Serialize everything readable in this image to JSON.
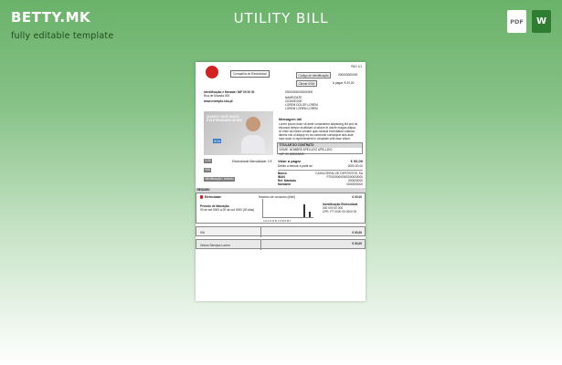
{
  "brand": {
    "name": "BETTY.MK",
    "tagline": "fully editable template"
  },
  "page_title": "UTILITY BILL",
  "formats": [
    {
      "label": "PDF",
      "icon": "pdf-file-icon"
    },
    {
      "label": "W",
      "icon": "word-file-icon"
    }
  ],
  "colors": {
    "background_top": "#6ab26a",
    "background_bottom": "#ffffff",
    "logo_red": "#d32020"
  },
  "document": {
    "page_number": "PAG 1/1",
    "company_name": "Compañía de Electricidad",
    "ref_label": "Código de identificação",
    "ref_value": "000000000000",
    "client_label": "Cliente 0000",
    "client_value": "A pagar: € 00,00",
    "address_title": "Identificação e Morada / NIF 00 00 00",
    "address_line": "Rua de Morada 000",
    "website": "www.exemplo.edu.pt",
    "recipient_code": "00000000000000000",
    "recipient_lines": [
      "NAME/DATE",
      "CIDADE/000",
      "LOREM DOLOR LOREM",
      "LOREM LOREM LOREM"
    ],
    "ad_headline_1": "QUANTO VOCÊ GOSTA",
    "ad_headline_2": "E ELETRICIDADE DE 80%",
    "ad_badge": "BCM",
    "tab_1": "0,00",
    "tab_1_label": "Electricidade Mensalidade: 0 €",
    "tab_2": "N/A",
    "tab_3": "Identificação / Adesão",
    "message_title": "Mensagem útil",
    "message_lines": [
      "Lorem ipsum dolor sit amet consectetur adipiscing elit sed do",
      "eiusmod tempor incididunt ut labore et dolore magna aliqua.",
      "Ut enim ad minim veniam quis nostrud exercitation ullamco",
      "laboris nisi ut aliquip ex ea commodo consequat duis aute",
      "irure dolor in reprehenderit in voluptate velit esse cillum."
    ],
    "contract_head": "TITULAR DO CONTRATO",
    "contract_name": "NOME: NOMBRE APELLIDO APELLIDO",
    "contract_nif": "NIF: 00 000000000",
    "pay_label": "Valor a pagar",
    "pay_value": "€ 00,00",
    "due_label": "Débito a efetuar a partir de",
    "due_value": "0000-00-00",
    "bank_rows": [
      {
        "label": "Banco",
        "value": "CAIXA GERAL DE DEPÓSITOS, SA"
      },
      {
        "label": "IBAN",
        "value": "PT00000000000000000000"
      },
      {
        "label": "Ref. Mandato",
        "value": "000000000"
      },
      {
        "label": "Montante",
        "value": "0000000000"
      }
    ],
    "summary_head": "RESUMO",
    "elec_title": "Eletricidade",
    "history_title": "Histórico de consumo (kWh)",
    "elec_value": "€ 00,00",
    "period_title": "Período de faturação",
    "period_line": "00 de set 0000 a 00 de out 0000 (00 dias)",
    "chart_letters": "J  A  S  O  N  D  J  F  M  A  M  J",
    "side_title": "Identificação Eletricidade",
    "side_lines": [
      "000 000 00 000",
      "CPE: PT 0000 00 0000 00"
    ],
    "iva_label": "IVA",
    "iva_value": "€ 00,00",
    "other_label": "Outros Serviços Lorem",
    "other_value": "€ 00,00"
  }
}
